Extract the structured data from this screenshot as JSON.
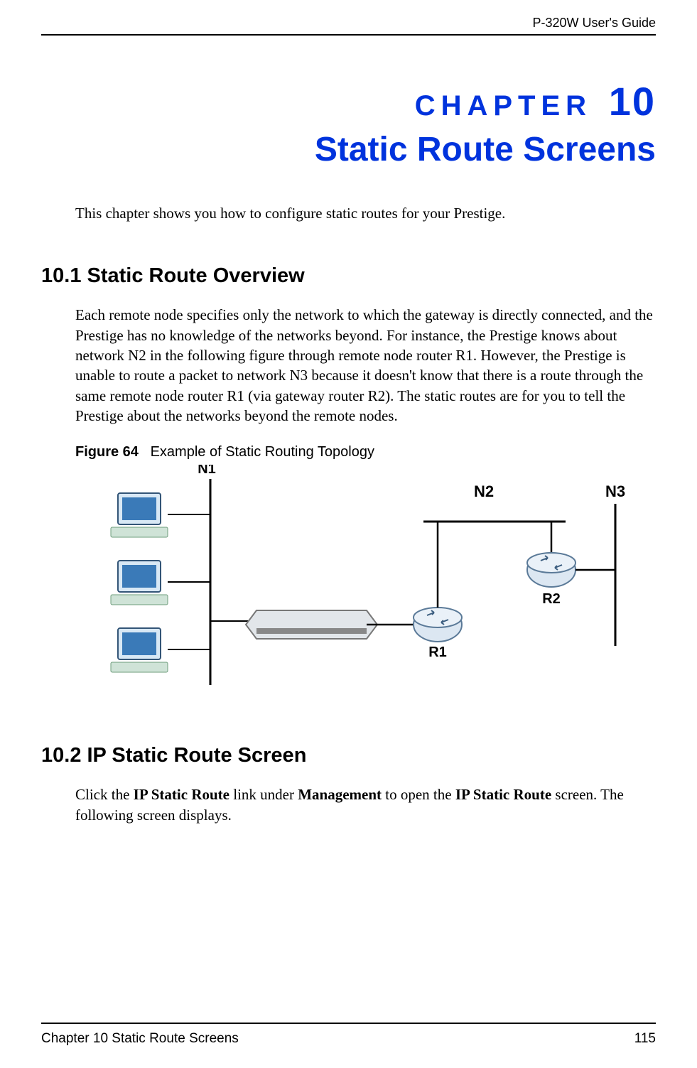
{
  "header": {
    "guide_title": "P-320W User's Guide"
  },
  "chapter": {
    "label_text": "CHAPTER",
    "number": "10",
    "title": "Static Route Screens"
  },
  "intro": "This chapter shows you how to configure static routes for your Prestige.",
  "section_10_1": {
    "heading": "10.1  Static Route Overview",
    "body": "Each remote node specifies only the network to which the gateway is directly connected, and the Prestige has no knowledge of the networks beyond. For instance, the Prestige knows about network N2 in the following figure through remote node router R1. However, the Prestige is unable to route a packet to network N3 because it doesn't know that there is a route through the same remote node router R1 (via gateway router R2). The static routes are for you to tell the Prestige about the networks beyond the remote nodes."
  },
  "figure": {
    "label": "Figure 64",
    "caption": "Example of Static Routing Topology",
    "labels": {
      "n1": "N1",
      "n2": "N2",
      "n3": "N3",
      "r1": "R1",
      "r2": "R2"
    }
  },
  "section_10_2": {
    "heading": "10.2  IP Static Route Screen",
    "body_pre": "Click the ",
    "bold1": "IP Static Route",
    "body_mid1": " link under ",
    "bold2": "Management",
    "body_mid2": " to open the ",
    "bold3": "IP Static Route",
    "body_post": " screen. The following screen displays."
  },
  "footer": {
    "chapter_ref": "Chapter 10 Static Route Screens",
    "page_number": "115"
  }
}
